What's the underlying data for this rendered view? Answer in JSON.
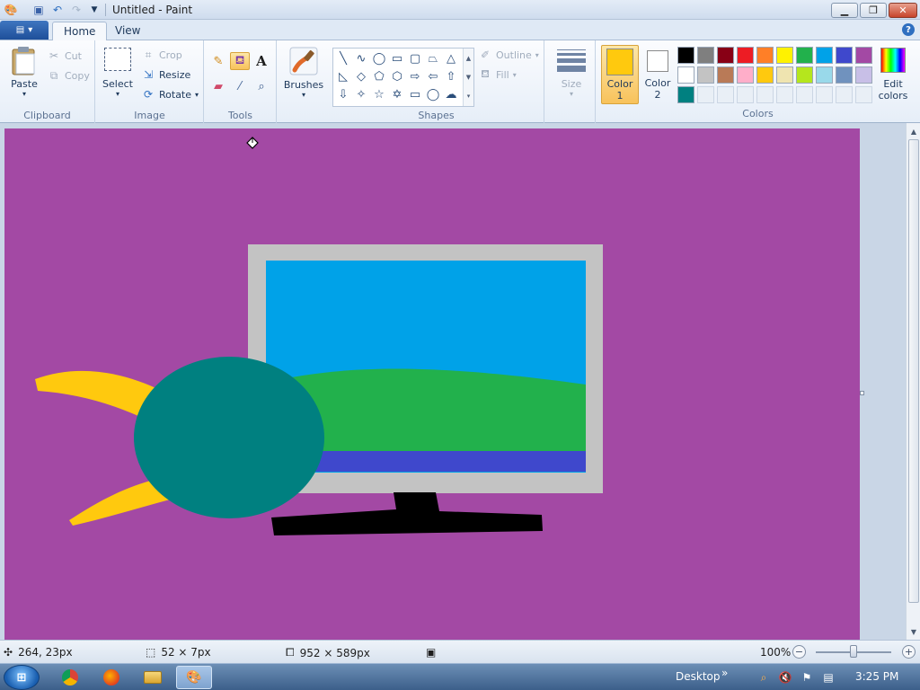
{
  "window": {
    "title": "Untitled - Paint",
    "minimize_glyph": "▁",
    "restore_glyph": "❐",
    "close_glyph": "✕"
  },
  "qat": {
    "app_icon": "paint-app-icon",
    "save_icon": "save-icon",
    "undo_icon": "undo-icon",
    "redo_icon": "redo-icon",
    "customize_icon": "dropdown-icon"
  },
  "tabs": {
    "home": "Home",
    "view": "View",
    "help": "?"
  },
  "ribbon": {
    "clipboard": {
      "label": "Clipboard",
      "paste": "Paste",
      "cut": "Cut",
      "copy": "Copy"
    },
    "image": {
      "label": "Image",
      "select": "Select",
      "crop": "Crop",
      "resize": "Resize",
      "rotate": "Rotate"
    },
    "tools": {
      "label": "Tools",
      "text_tool_glyph": "A"
    },
    "brushes": {
      "label": "Brushes"
    },
    "shapes": {
      "label": "Shapes",
      "outline": "Outline",
      "fill": "Fill"
    },
    "size": {
      "label": "Size"
    },
    "colors": {
      "label": "Colors",
      "color1": "Color 1",
      "color1_line1": "Color",
      "color1_line2": "1",
      "color2_line1": "Color",
      "color2_line2": "2",
      "edit_line1": "Edit",
      "edit_line2": "colors",
      "color1_value": "#ffc90e",
      "color2_value": "#ffffff",
      "palette_row1": [
        "#000000",
        "#7f7f7f",
        "#880015",
        "#ed1c24",
        "#ff7f27",
        "#fff200",
        "#22b14c",
        "#00a2e8",
        "#3f48cc",
        "#a349a4"
      ],
      "palette_row2": [
        "#ffffff",
        "#c3c3c3",
        "#b97a57",
        "#ffaec9",
        "#ffc90e",
        "#efe4b0",
        "#b5e61d",
        "#99d9ea",
        "#7092be",
        "#c8bfe7"
      ],
      "palette_row3": [
        "#008080"
      ]
    }
  },
  "canvas": {
    "background": "#a349a4",
    "monitor_frame": "#c3c3c3",
    "sky": "#00a2e8",
    "hill": "#22b14c",
    "water": "#3f48cc",
    "stand": "#000000",
    "ball": "#008080",
    "wings": "#ffc90e"
  },
  "status": {
    "cursor_pos": "264, 23px",
    "selection_size": "52 × 7px",
    "canvas_size": "952 × 589px",
    "zoom": "100%"
  },
  "taskbar": {
    "desktop": "Desktop",
    "chevrons": "»",
    "time": "3:25 PM"
  }
}
